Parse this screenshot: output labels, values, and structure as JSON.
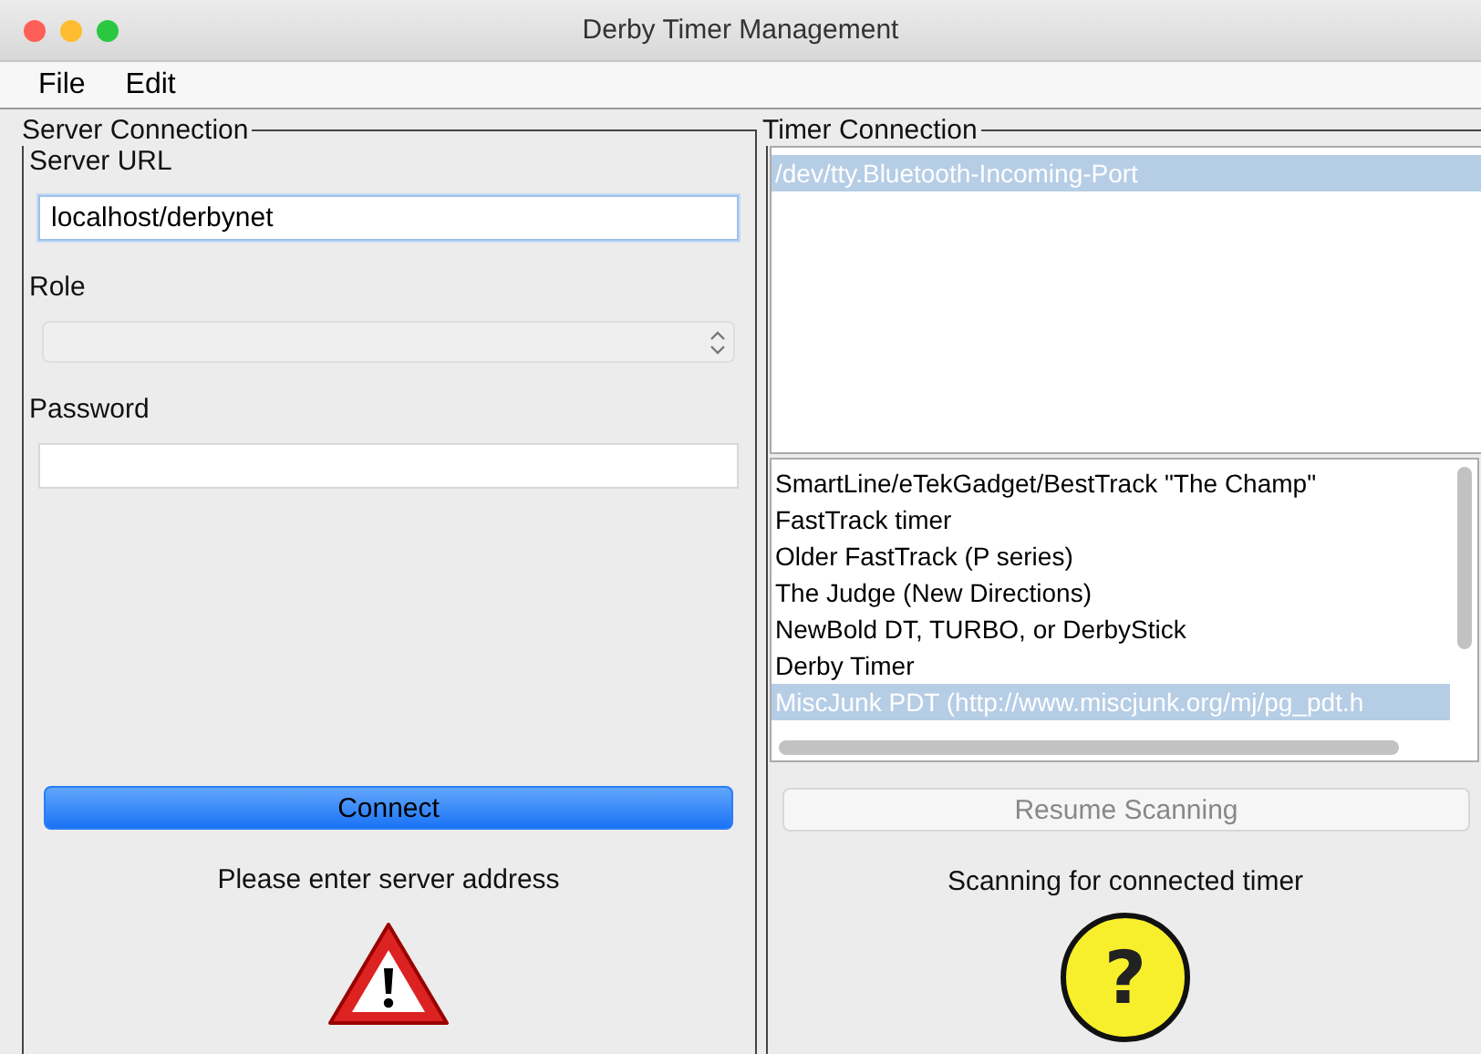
{
  "window": {
    "title": "Derby Timer Management"
  },
  "menu": [
    {
      "label": "File"
    },
    {
      "label": "Edit"
    }
  ],
  "server_connection": {
    "title": "Server Connection",
    "fields": [
      {
        "kind": "text",
        "label": "Server URL",
        "value": "localhost/derbynet",
        "focused": true
      },
      {
        "kind": "select",
        "label": "Role",
        "disabled": true
      },
      {
        "kind": "password",
        "label": "Password"
      }
    ],
    "button": {
      "label": "Connect",
      "default": true,
      "disabled": false
    },
    "message": "Please enter server address",
    "status_icon": {
      "kind": "warning"
    }
  },
  "timer_connection": {
    "title": "Timer Connection",
    "ports": [
      {
        "label": "/dev/tty.Bluetooth-Incoming-Port",
        "selected": true
      }
    ],
    "timers": [
      {
        "label": "SmartLine/eTekGadget/BestTrack \"The Champ\"",
        "selected": false
      },
      {
        "label": "FastTrack timer",
        "selected": false
      },
      {
        "label": "Older FastTrack (P series)",
        "selected": false
      },
      {
        "label": "The Judge (New Directions)",
        "selected": false
      },
      {
        "label": "NewBold DT, TURBO, or DerbyStick",
        "selected": false
      },
      {
        "label": "Derby Timer",
        "selected": false
      },
      {
        "label": "MiscJunk PDT (http://www.miscjunk.org/mj/pg_pdt.h",
        "selected": true
      }
    ],
    "button": {
      "label": "Resume Scanning",
      "default": false,
      "disabled": true
    },
    "message": "Scanning for connected timer",
    "status_icon": {
      "kind": "question",
      "symbol": "?"
    }
  }
}
